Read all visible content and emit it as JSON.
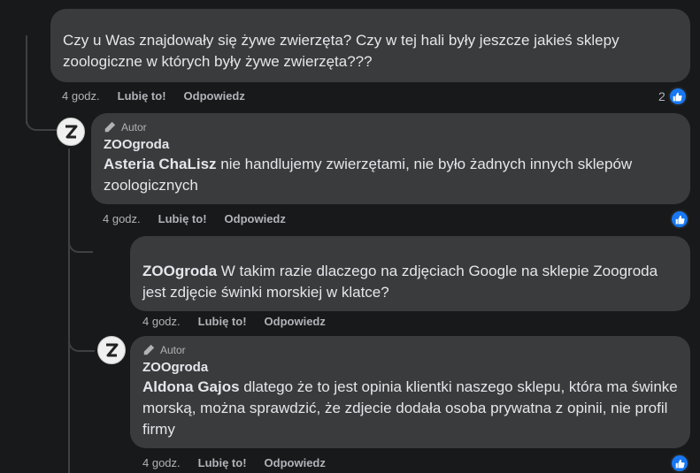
{
  "comments": [
    {
      "text": "Czy u Was znajdowały się żywe zwierzęta? Czy w tej hali były jeszcze jakieś sklepy zoologiczne w których były żywe zwierzęta???",
      "time": "4 godz.",
      "like": "Lubię to!",
      "reply": "Odpowiedz",
      "reactions": "2"
    },
    {
      "badge": "Autor",
      "name": "ZOOgroda",
      "mention": "Asteria ChaLisz",
      "text": " nie handlujemy zwierzętami, nie było żadnych innych sklepów zoologicznych",
      "time": "4 godz.",
      "like": "Lubię to!",
      "reply": "Odpowiedz"
    },
    {
      "mention": "ZOOgroda",
      "text": " W takim razie dlaczego na zdjęciach Google na sklepie Zoogroda jest zdjęcie świnki morskiej w klatce?",
      "time": "4 godz.",
      "like": "Lubię to!",
      "reply": "Odpowiedz"
    },
    {
      "badge": "Autor",
      "name": "ZOOgroda",
      "mention": "Aldona Gajos",
      "text": " dlatego że to jest opinia klientki naszego sklepu, która ma świnke morską, można sprawdzić, że zdjecie dodała osoba prywatna z opinii, nie profil firmy",
      "time": "4 godz.",
      "like": "Lubię to!",
      "reply": "Odpowiedz"
    }
  ],
  "colors": {
    "bubble": "#3a3b3c",
    "like_blue": "#1877f2",
    "background": "#18191a"
  },
  "icons": {
    "author_badge": "pencil-icon",
    "reaction": "thumbs-up-icon"
  }
}
